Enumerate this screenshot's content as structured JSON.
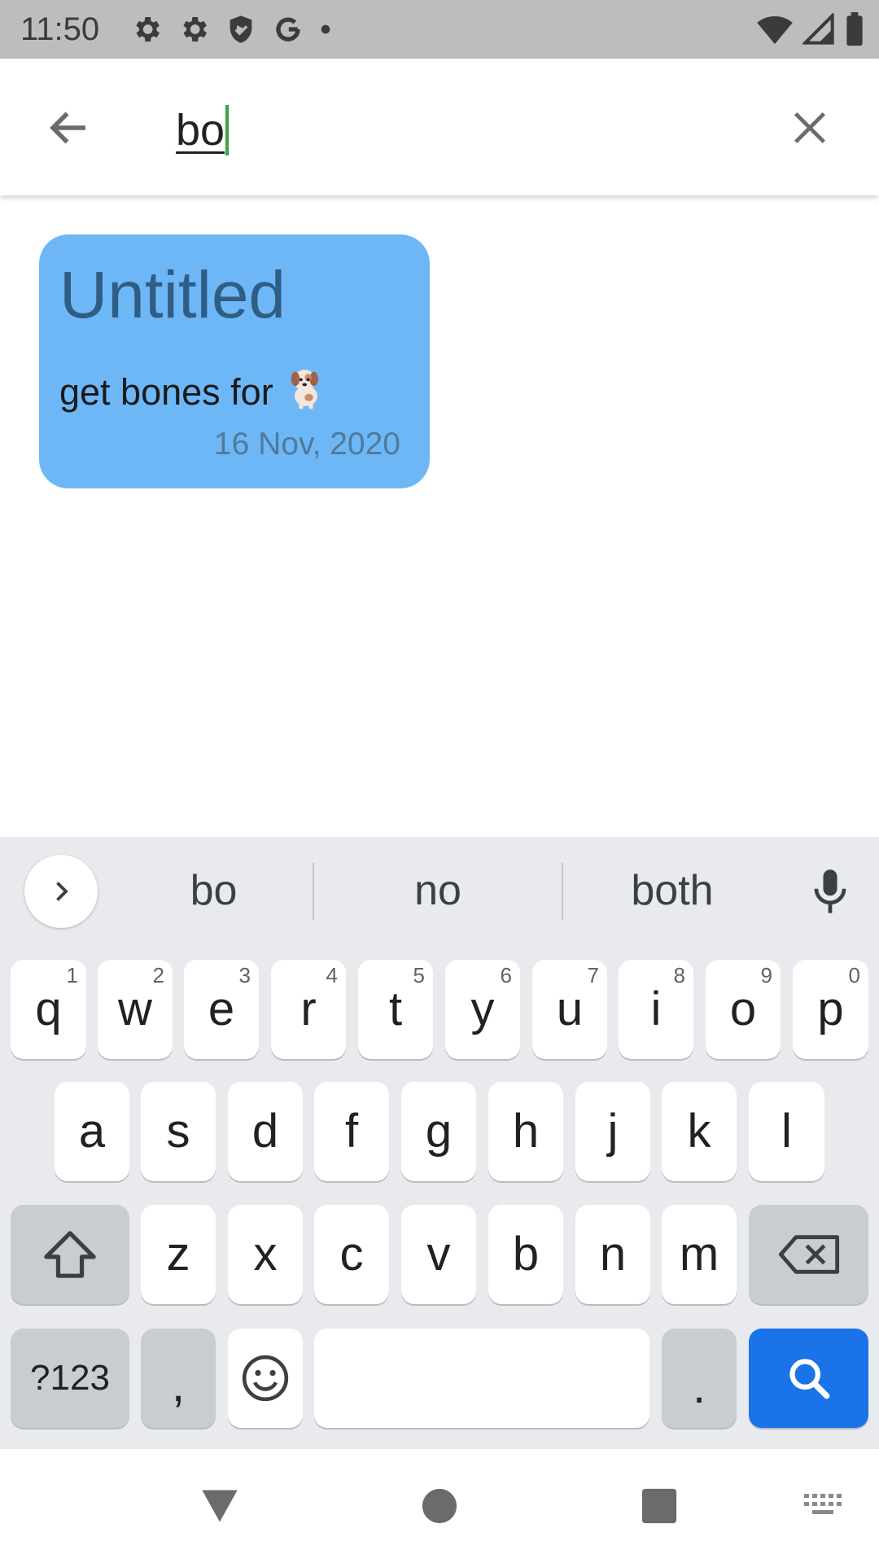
{
  "status_bar": {
    "time": "11:50",
    "icons_left": [
      "settings-icon",
      "settings-icon",
      "shield-icon",
      "google-icon",
      "dot-icon"
    ],
    "icons_right": [
      "wifi-icon",
      "signal-icon",
      "battery-icon"
    ]
  },
  "search": {
    "query": "bo",
    "back_icon": "arrow-left-icon",
    "clear_icon": "close-icon"
  },
  "results": [
    {
      "title": "Untitled",
      "body": "get bones for",
      "emoji": "dog-icon",
      "date": "16 Nov, 2020",
      "color": "#6eb7f7"
    }
  ],
  "keyboard": {
    "suggestions": [
      "bo",
      "no",
      "both"
    ],
    "row1": [
      {
        "label": "q",
        "hint": "1"
      },
      {
        "label": "w",
        "hint": "2"
      },
      {
        "label": "e",
        "hint": "3"
      },
      {
        "label": "r",
        "hint": "4"
      },
      {
        "label": "t",
        "hint": "5"
      },
      {
        "label": "y",
        "hint": "6"
      },
      {
        "label": "u",
        "hint": "7"
      },
      {
        "label": "i",
        "hint": "8"
      },
      {
        "label": "o",
        "hint": "9"
      },
      {
        "label": "p",
        "hint": "0"
      }
    ],
    "row2": [
      "a",
      "s",
      "d",
      "f",
      "g",
      "h",
      "j",
      "k",
      "l"
    ],
    "row3": [
      "z",
      "x",
      "c",
      "v",
      "b",
      "n",
      "m"
    ],
    "symbols_label": "?123",
    "comma_label": ",",
    "period_label": ".",
    "accent_color": "#1a73e8"
  },
  "nav": {
    "icons": [
      "back-triangle-icon",
      "home-circle-icon",
      "recents-square-icon",
      "keyboard-switch-icon"
    ]
  }
}
